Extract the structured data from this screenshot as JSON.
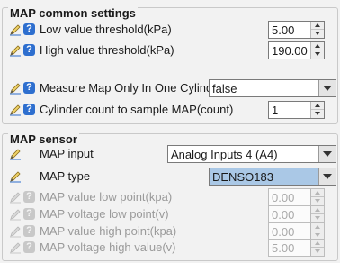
{
  "common": {
    "title": "MAP common settings",
    "rows": [
      {
        "label": "Low value threshold(kPa)",
        "value": "5.00"
      },
      {
        "label": "High value threshold(kPa)",
        "value": "190.00"
      },
      {
        "label": "Measure Map Only In One Cylinder",
        "value": "false"
      },
      {
        "label": "Cylinder count to sample MAP(count)",
        "value": "1"
      }
    ]
  },
  "sensor": {
    "title": "MAP sensor",
    "input_label": "MAP input",
    "input_value": "Analog Inputs 4 (A4)",
    "type_label": "MAP type",
    "type_value": "DENSO183",
    "disabled_rows": [
      {
        "label": "MAP value low point(kpa)",
        "value": "0.00"
      },
      {
        "label": "MAP voltage low point(v)",
        "value": "0.00"
      },
      {
        "label": "MAP value high point(kpa)",
        "value": "0.00"
      },
      {
        "label": "MAP voltage high value(v)",
        "value": "5.00"
      }
    ]
  },
  "icons": {
    "edit": "pencil-icon",
    "help": "help-icon"
  },
  "colors": {
    "help": "#2e6fcf",
    "selected": "#aac8e6",
    "disabled_text": "#9a9a9a"
  }
}
